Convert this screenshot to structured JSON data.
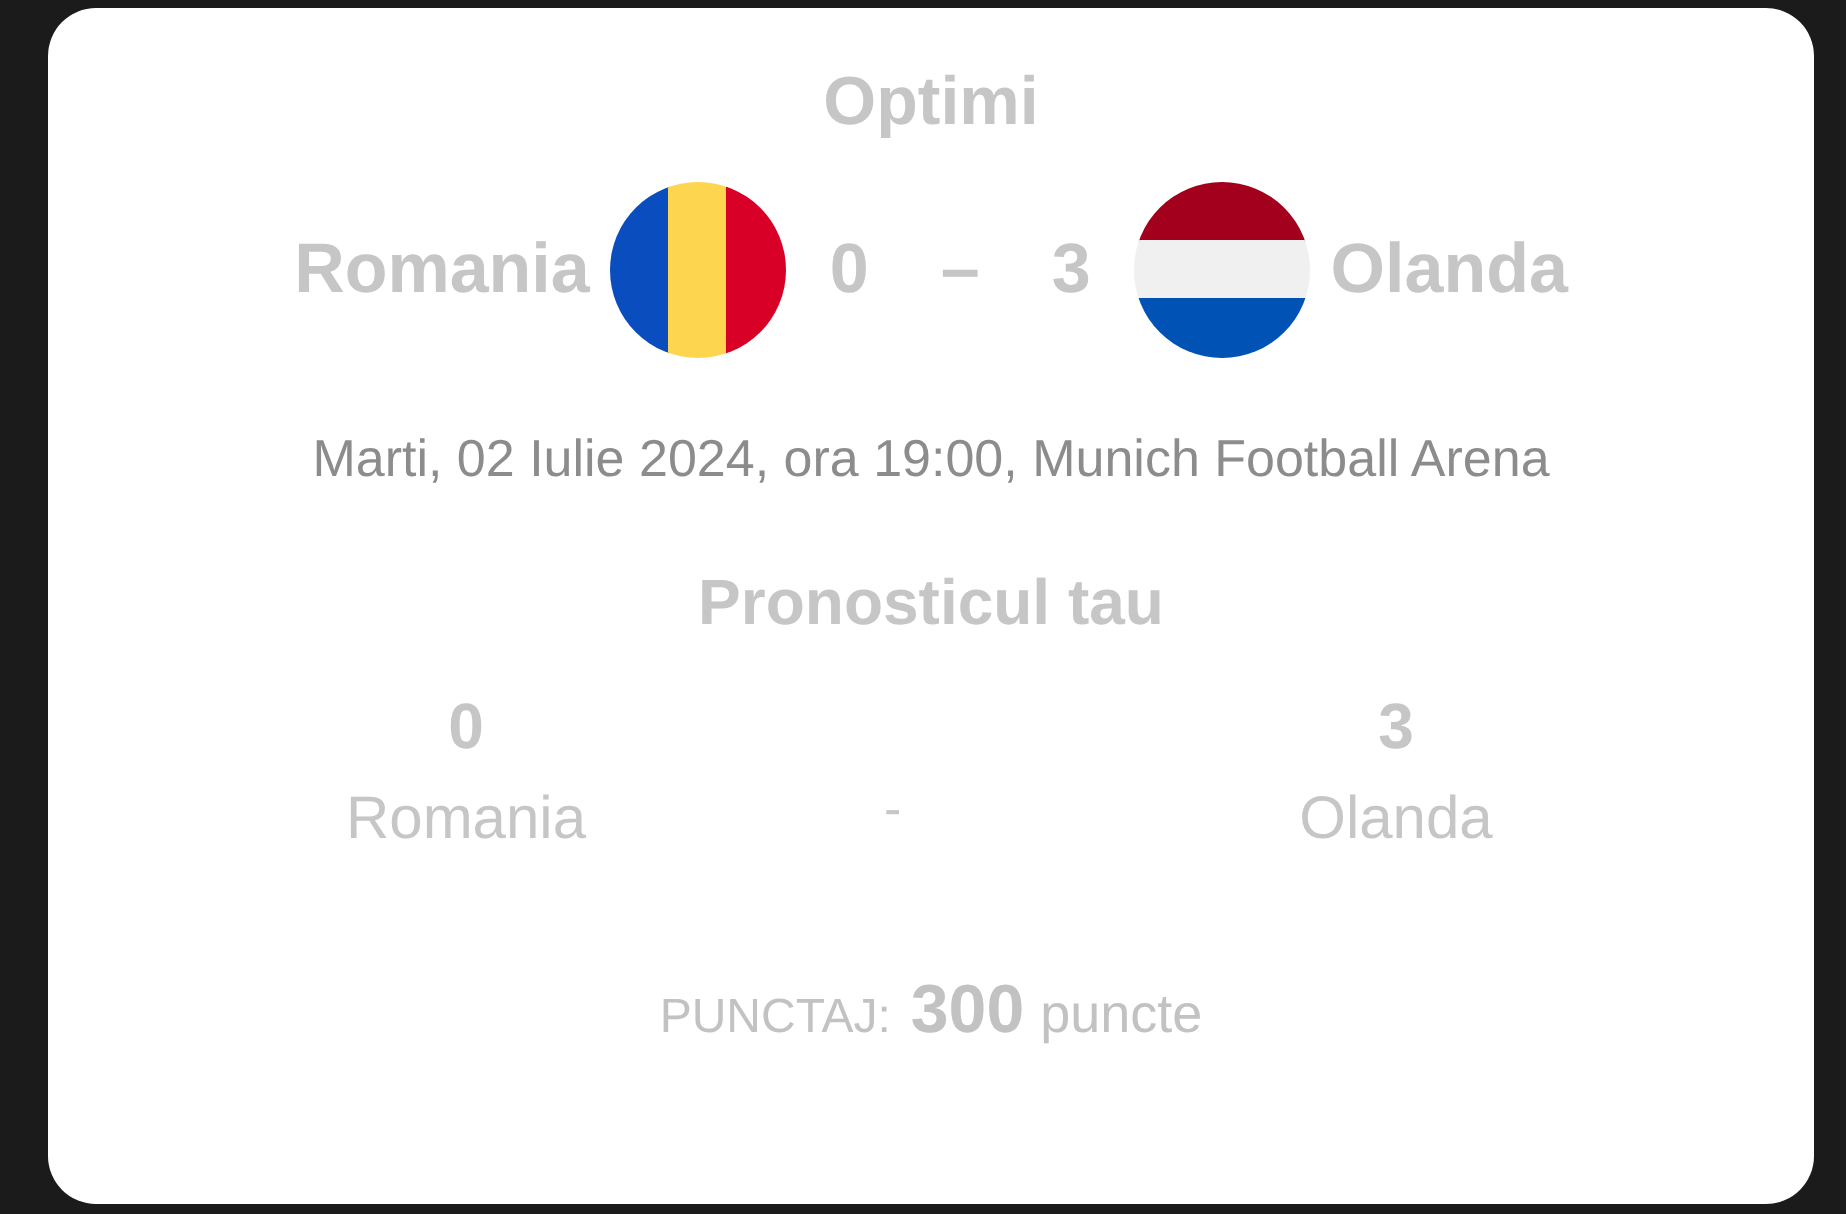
{
  "stage": "Optimi",
  "match": {
    "home": {
      "name": "Romania",
      "score": "0"
    },
    "separator": "–",
    "away": {
      "name": "Olanda",
      "score": "3"
    }
  },
  "details": "Marti, 02 Iulie 2024, ora 19:00, Munich Football Arena",
  "prediction": {
    "title": "Pronosticul tau",
    "home": {
      "score": "0",
      "name": "Romania"
    },
    "separator": "-",
    "away": {
      "score": "3",
      "name": "Olanda"
    }
  },
  "points": {
    "label": "PUNCTAJ:",
    "value": "300",
    "unit": "puncte"
  }
}
